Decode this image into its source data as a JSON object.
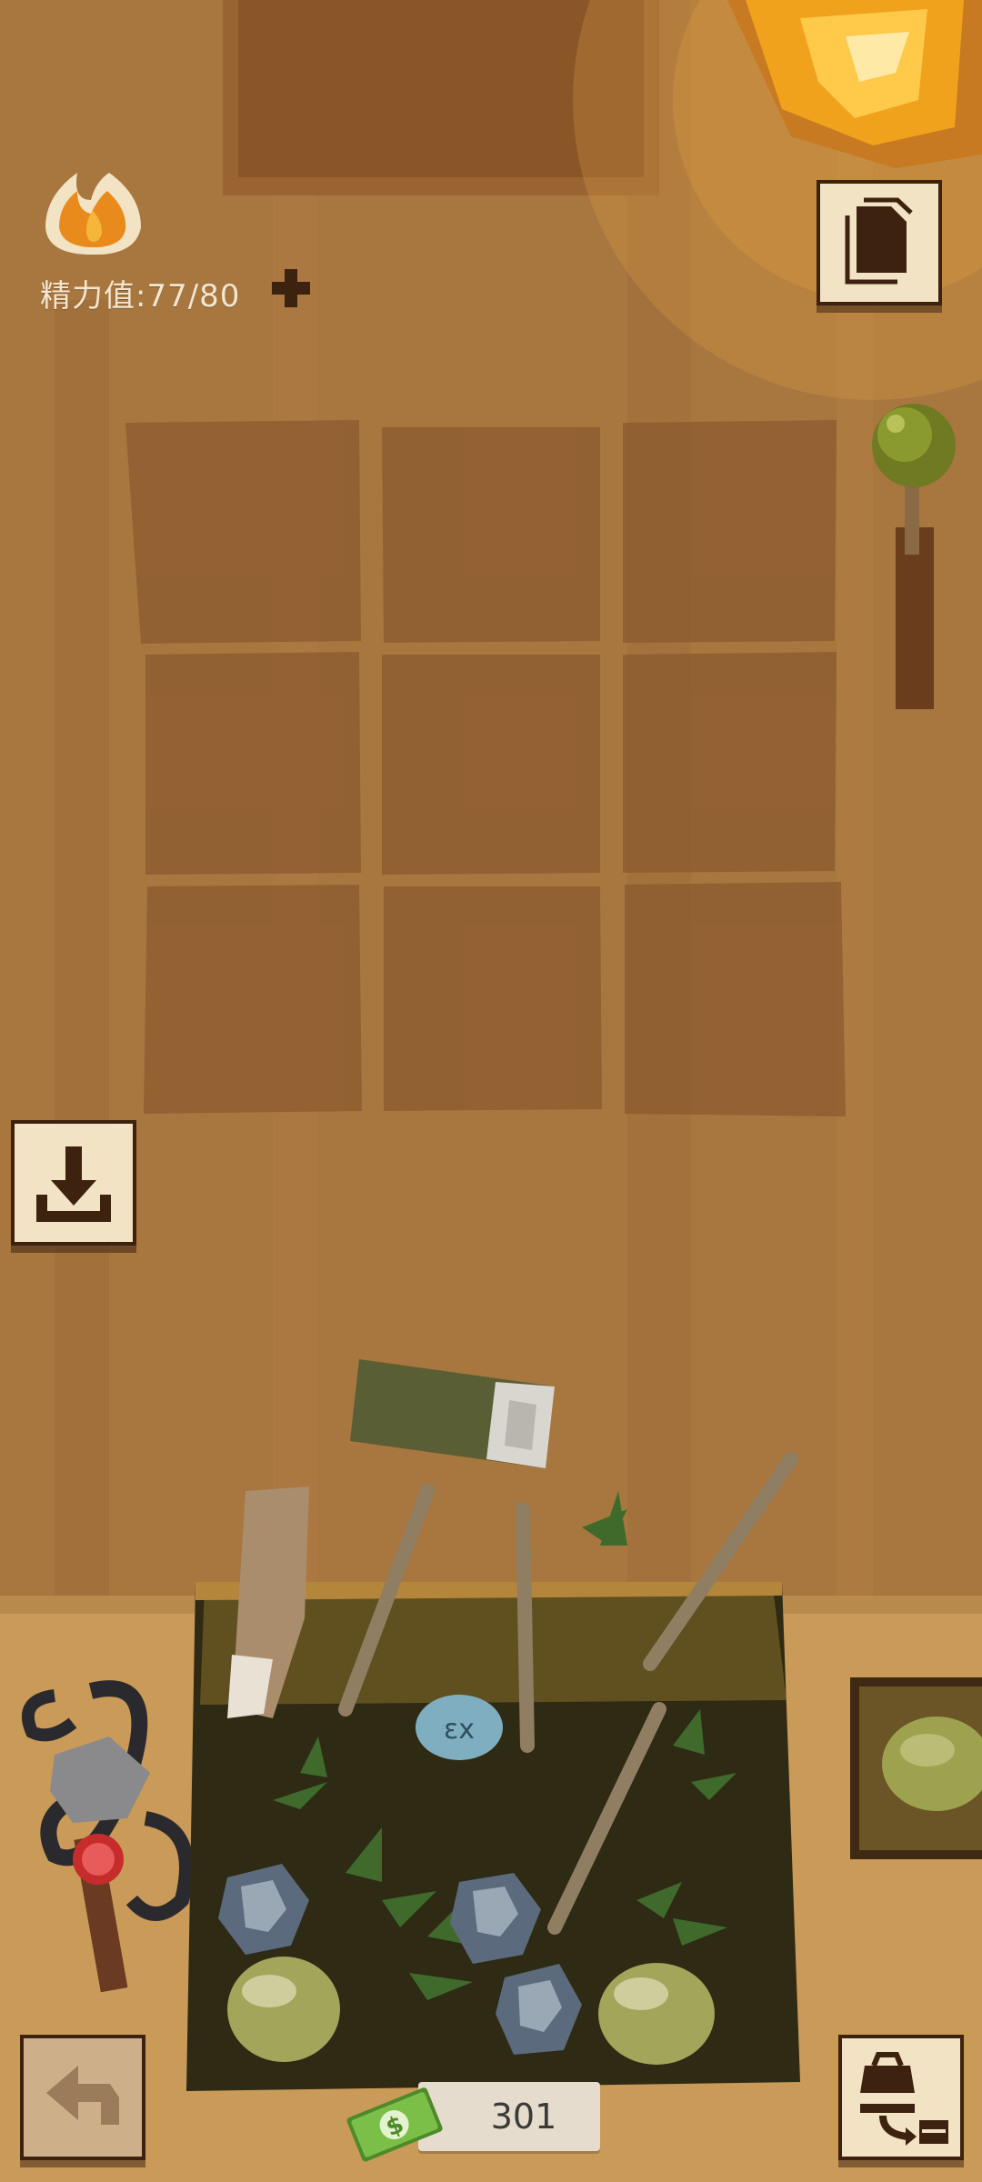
{
  "hud": {
    "energy_label": "精力值:77/80",
    "energy_current": 77,
    "energy_max": 80
  },
  "icons": {
    "energy": "flame-icon",
    "add_energy": "plus-icon",
    "documents": "documents-icon",
    "download": "download-icon",
    "undo": "undo-arrow-icon",
    "inventory_transfer": "backpack-chest-icon",
    "money": "cash-icon"
  },
  "wallet": {
    "money_value": "301"
  },
  "colors": {
    "wall": "#a8763f",
    "floor": "#c99a58",
    "paper_button": "#f2e3c4",
    "dark_outline": "#3e2210",
    "energy_text": "#f4e6cf",
    "cash_green": "#6da93d"
  }
}
